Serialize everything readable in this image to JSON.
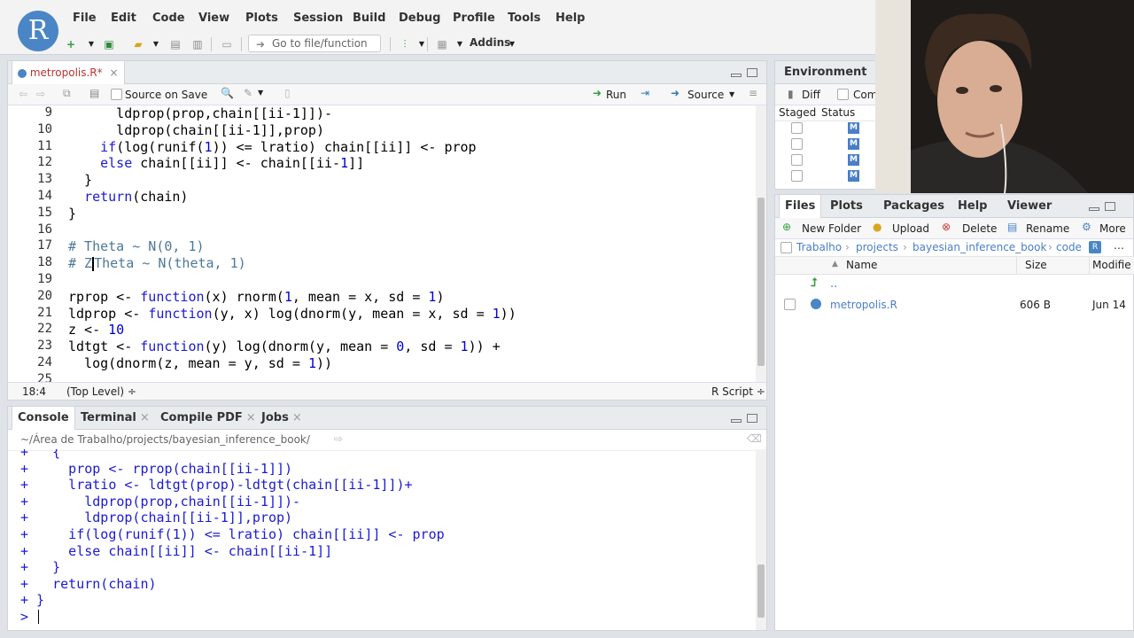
{
  "menu": [
    "File",
    "Edit",
    "Code",
    "View",
    "Plots",
    "Session",
    "Build",
    "Debug",
    "Profile",
    "Tools",
    "Help"
  ],
  "toolbar": {
    "goto_placeholder": "Go to file/function",
    "addins_label": "Addins"
  },
  "editor": {
    "tab_label": "metropolis.R*",
    "source_on_save": "Source on Save",
    "run_label": "Run",
    "source_label": "Source",
    "lines": [
      {
        "n": "9",
        "html": "      ldprop(prop,chain[[ii-1]])-"
      },
      {
        "n": "10",
        "html": "      ldprop(chain[[ii-1]],prop)"
      },
      {
        "n": "11",
        "html": "    <span class=\"kw\">if</span>(log(runif(<span class=\"num\">1</span>)) &lt;= lratio) chain[[ii]] &lt;- prop"
      },
      {
        "n": "12",
        "html": "    <span class=\"kw\">else</span> chain[[ii]] &lt;- chain[[ii-<span class=\"num\">1</span>]]"
      },
      {
        "n": "13",
        "html": "  }"
      },
      {
        "n": "14",
        "html": "  <span class=\"kw\">return</span>(chain)"
      },
      {
        "n": "15",
        "html": "}"
      },
      {
        "n": "16",
        "html": ""
      },
      {
        "n": "17",
        "html": "<span class=\"cm\"># Theta ~ N(0, 1)</span>"
      },
      {
        "n": "18",
        "html": "<span class=\"cm\"># Z</span><span class=\"cursor\"></span><span class=\"cm\">Theta ~ N(theta, 1)</span>"
      },
      {
        "n": "19",
        "html": ""
      },
      {
        "n": "20",
        "html": "rprop &lt;- <span class=\"kw\">function</span>(x) rnorm(<span class=\"num\">1</span>, mean = x, sd = <span class=\"num\">1</span>)"
      },
      {
        "n": "21",
        "html": "ldprop &lt;- <span class=\"kw\">function</span>(y, x) log(dnorm(y, mean = x, sd = <span class=\"num\">1</span>))"
      },
      {
        "n": "22",
        "html": "z &lt;- <span class=\"num\">10</span>"
      },
      {
        "n": "23",
        "html": "ldtgt &lt;- <span class=\"kw\">function</span>(y) log(dnorm(y, mean = <span class=\"num\">0</span>, sd = <span class=\"num\">1</span>)) +"
      },
      {
        "n": "24",
        "html": "  log(dnorm(z, mean = y, sd = <span class=\"num\">1</span>))"
      },
      {
        "n": "25",
        "html": ""
      }
    ],
    "status_pos": "18:4",
    "status_scope": "(Top Level) ÷",
    "status_type": "R Script ÷"
  },
  "console": {
    "tabs": [
      "Console",
      "Terminal",
      "Compile PDF",
      "Jobs"
    ],
    "path": "~/Área de Trabalho/projects/bayesian_inference_book/",
    "lines": [
      "+   {",
      "+     prop <- rprop(chain[[ii-1]])",
      "+     lratio <- ldtgt(prop)-ldtgt(chain[[ii-1]])+",
      "+       ldprop(prop,chain[[ii-1]])-",
      "+       ldprop(chain[[ii-1]],prop)",
      "+     if(log(runif(1)) <= lratio) chain[[ii]] <- prop",
      "+     else chain[[ii]] <- chain[[ii-1]]",
      "+   }",
      "+   return(chain)",
      "+ }",
      "> "
    ]
  },
  "environment": {
    "tab": "Environment",
    "diff": "Diff",
    "commit": "Com",
    "col_staged": "Staged",
    "col_status": "Status",
    "status_badge": "M"
  },
  "files": {
    "tabs": [
      "Files",
      "Plots",
      "Packages",
      "Help",
      "Viewer"
    ],
    "actions": [
      "New Folder",
      "Upload",
      "Delete",
      "Rename",
      "More"
    ],
    "breadcrumb": [
      "Trabalho",
      "projects",
      "bayesian_inference_book",
      "code"
    ],
    "col_name": "Name",
    "col_size": "Size",
    "col_modified": "Modifie",
    "parent": "..",
    "rows": [
      {
        "name": "metropolis.R",
        "size": "606 B",
        "modified": "Jun 14"
      }
    ]
  },
  "colors": {
    "accent": "#4a86c5",
    "keyword": "#1a1ad4",
    "comment": "#4d7899"
  }
}
